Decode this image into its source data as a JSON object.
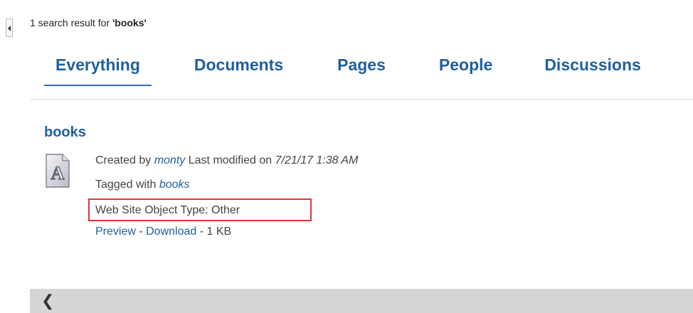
{
  "search": {
    "count_prefix": "1 search result for ",
    "term": "'books'"
  },
  "tabs": [
    {
      "label": "Everything",
      "active": true
    },
    {
      "label": "Documents",
      "active": false
    },
    {
      "label": "Pages",
      "active": false
    },
    {
      "label": "People",
      "active": false
    },
    {
      "label": "Discussions",
      "active": false
    }
  ],
  "result": {
    "title": "books",
    "icon": "document-a-icon",
    "created_label": "Created by",
    "author": "monty",
    "modified_label": "Last modified on",
    "modified_date": "7/21/17 1:38 AM",
    "tagged_label": "Tagged with",
    "tag": "books",
    "object_type": "Web Site Object Type: Other",
    "preview_label": "Preview",
    "download_label": "Download",
    "size": "1 KB"
  },
  "colors": {
    "link": "#1f5f9e",
    "highlight_box": "#e03535"
  }
}
